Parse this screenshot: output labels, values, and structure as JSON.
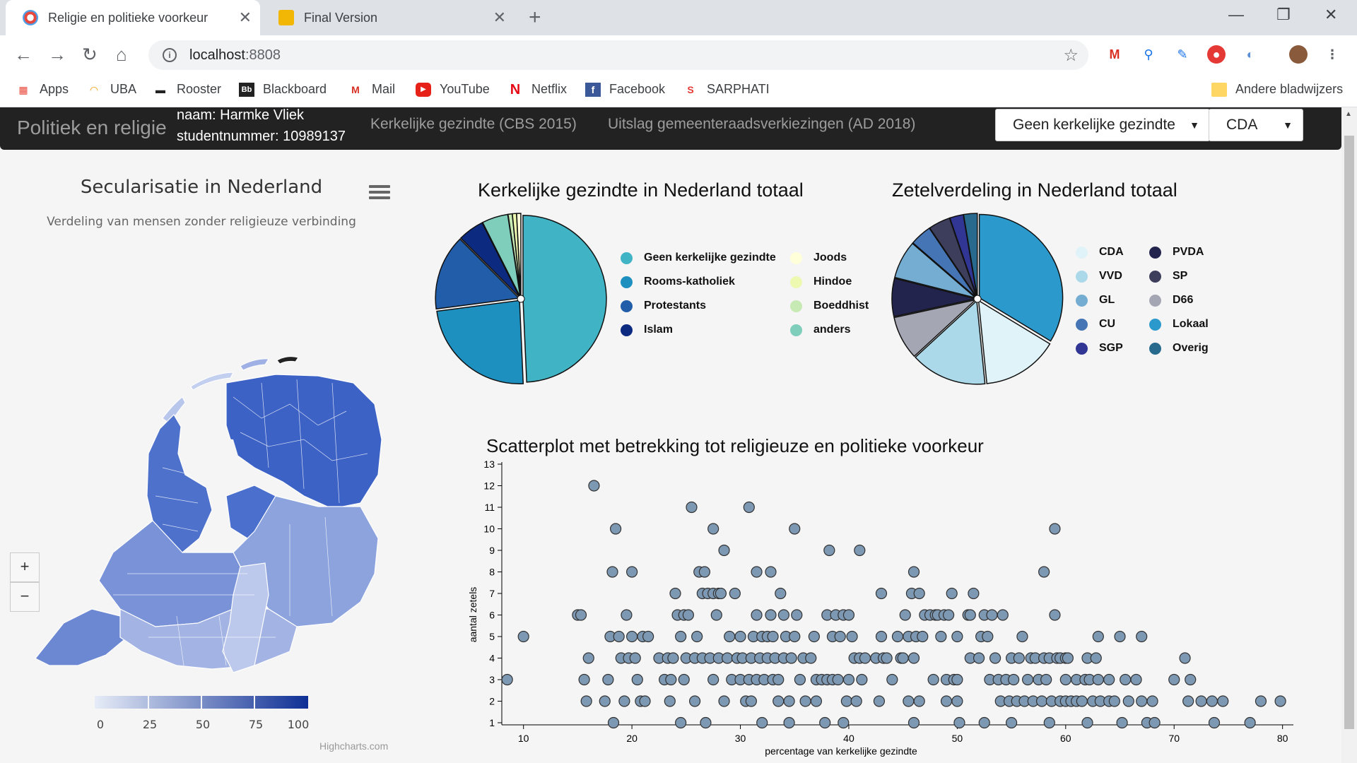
{
  "browser": {
    "tabs": [
      {
        "title": "Religie en politieke voorkeur",
        "active": true
      },
      {
        "title": "Final Version",
        "active": false
      }
    ],
    "url_host": "localhost",
    "url_port": ":8808",
    "bookmarks": [
      "Apps",
      "UBA",
      "Rooster",
      "Blackboard",
      "Mail",
      "YouTube",
      "Netflix",
      "Facebook",
      "SARPHATI"
    ],
    "other_bookmarks": "Andere bladwijzers"
  },
  "navbar": {
    "brand": "Politiek en religie",
    "student_name": "naam: Harmke Vliek",
    "student_number": "studentnummer: 10989137",
    "link_cbs": "Kerkelijke gezindte (CBS 2015)",
    "link_ad": "Uitslag gemeenteraadsverkiezingen (AD 2018)",
    "select_religion": "Geen kerkelijke gezindte",
    "select_party": "CDA"
  },
  "map": {
    "title": "Secularisatie in Nederland",
    "subtitle": "Verdeling van mensen zonder religieuze verbinding",
    "zoom_in": "+",
    "zoom_out": "−",
    "legend_labels": [
      "0",
      "25",
      "50",
      "75",
      "100"
    ],
    "credits": "Highcharts.com"
  },
  "colors": {
    "navbar_bg": "#222222",
    "map_low": "#e6ecf7",
    "map_high": "#0e2f95",
    "scatter_point": "#7d98b3"
  },
  "chart_data": [
    {
      "type": "pie",
      "title": "Kerkelijke gezindte in Nederland totaal",
      "slices": [
        {
          "label": "Geen kerkelijke gezindte",
          "value": 49.0,
          "color": "#40b4c4"
        },
        {
          "label": "Rooms-katholiek",
          "value": 23.5,
          "color": "#1d90c0"
        },
        {
          "label": "Protestants",
          "value": 14.5,
          "color": "#215da8"
        },
        {
          "label": "Islam",
          "value": 5.0,
          "color": "#0c2a80"
        },
        {
          "label": "anders",
          "value": 5.0,
          "color": "#7fcdbb"
        },
        {
          "label": "Boeddhist",
          "value": 0.8,
          "color": "#c7e9b4"
        },
        {
          "label": "Hindoe",
          "value": 0.8,
          "color": "#edf8b1"
        },
        {
          "label": "Joods",
          "value": 0.8,
          "color": "#ffffd9"
        }
      ],
      "legend": [
        "Geen kerkelijke gezindte",
        "Rooms-katholiek",
        "Protestants",
        "Islam",
        "Joods",
        "Hindoe",
        "Boeddhist",
        "anders"
      ]
    },
    {
      "type": "pie",
      "title": "Zetelverdeling in Nederland totaal",
      "slices": [
        {
          "label": "Lokaal",
          "value": 32,
          "color": "#2b99cb"
        },
        {
          "label": "CDA",
          "value": 14,
          "color": "#e0f3f8"
        },
        {
          "label": "VVD",
          "value": 14,
          "color": "#abd9e9"
        },
        {
          "label": "D66",
          "value": 8,
          "color": "#a4a6b4"
        },
        {
          "label": "PVDA",
          "value": 7,
          "color": "#23244e"
        },
        {
          "label": "GL",
          "value": 7,
          "color": "#74add1"
        },
        {
          "label": "CU",
          "value": 4,
          "color": "#4575b4"
        },
        {
          "label": "SP",
          "value": 4,
          "color": "#3d3d5c"
        },
        {
          "label": "SGP",
          "value": 2.5,
          "color": "#313695"
        },
        {
          "label": "Overig",
          "value": 2.5,
          "color": "#276a8e"
        }
      ],
      "legend": [
        "CDA",
        "VVD",
        "GL",
        "CU",
        "SGP",
        "PVDA",
        "SP",
        "D66",
        "Lokaal",
        "Overig"
      ]
    },
    {
      "type": "scatter",
      "title": "Scatterplot met betrekking tot religieuze en politieke voorkeur",
      "xlabel": "percentage van kerkelijke gezindte",
      "ylabel": "aantal zetels",
      "xlim": [
        8,
        81
      ],
      "ylim": [
        1,
        13
      ],
      "xticks": [
        10,
        20,
        30,
        40,
        50,
        60,
        70,
        80
      ],
      "yticks": [
        1,
        2,
        3,
        4,
        5,
        6,
        7,
        8,
        9,
        10,
        11,
        12,
        13
      ],
      "points": [
        [
          8.5,
          3
        ],
        [
          10,
          5
        ],
        [
          15,
          6
        ],
        [
          15.3,
          6
        ],
        [
          15.6,
          3
        ],
        [
          15.8,
          2
        ],
        [
          16,
          4
        ],
        [
          16.5,
          12
        ],
        [
          17.5,
          2
        ],
        [
          17.8,
          3
        ],
        [
          18,
          5
        ],
        [
          18.2,
          8
        ],
        [
          18.3,
          1
        ],
        [
          18.5,
          10
        ],
        [
          18.8,
          5
        ],
        [
          19,
          4
        ],
        [
          19.3,
          2
        ],
        [
          19.5,
          6
        ],
        [
          19.7,
          4
        ],
        [
          20,
          8
        ],
        [
          20,
          5
        ],
        [
          20.3,
          4
        ],
        [
          20.5,
          3
        ],
        [
          20.8,
          2
        ],
        [
          21,
          5
        ],
        [
          21.2,
          2
        ],
        [
          21.5,
          5
        ],
        [
          22.5,
          4
        ],
        [
          23,
          3
        ],
        [
          23.3,
          4
        ],
        [
          23.5,
          2
        ],
        [
          23.6,
          3
        ],
        [
          23.8,
          4
        ],
        [
          24,
          7
        ],
        [
          24.2,
          6
        ],
        [
          24.5,
          5
        ],
        [
          24.5,
          1
        ],
        [
          24.8,
          6
        ],
        [
          24.8,
          3
        ],
        [
          25,
          4
        ],
        [
          25.2,
          6
        ],
        [
          25.5,
          11
        ],
        [
          25.8,
          2
        ],
        [
          25.8,
          4
        ],
        [
          26,
          5
        ],
        [
          26.2,
          8
        ],
        [
          26.5,
          4
        ],
        [
          26.5,
          7
        ],
        [
          26.7,
          8
        ],
        [
          26.8,
          1
        ],
        [
          27,
          7
        ],
        [
          27.2,
          4
        ],
        [
          27.5,
          10
        ],
        [
          27.5,
          7
        ],
        [
          27.5,
          3
        ],
        [
          27.8,
          6
        ],
        [
          28,
          7
        ],
        [
          28,
          4
        ],
        [
          28.2,
          7
        ],
        [
          28.5,
          2
        ],
        [
          28.5,
          9
        ],
        [
          28.8,
          4
        ],
        [
          29,
          5
        ],
        [
          29.2,
          3
        ],
        [
          29.5,
          7
        ],
        [
          29.7,
          4
        ],
        [
          30,
          5
        ],
        [
          30,
          3
        ],
        [
          30.2,
          4
        ],
        [
          30.5,
          2
        ],
        [
          30.8,
          11
        ],
        [
          30.8,
          3
        ],
        [
          31,
          2
        ],
        [
          31,
          4
        ],
        [
          31.2,
          5
        ],
        [
          31.5,
          8
        ],
        [
          31.5,
          6
        ],
        [
          31.5,
          3
        ],
        [
          31.8,
          4
        ],
        [
          32,
          5
        ],
        [
          32,
          1
        ],
        [
          32.2,
          3
        ],
        [
          32.5,
          4
        ],
        [
          32.5,
          5
        ],
        [
          32.8,
          6
        ],
        [
          32.8,
          8
        ],
        [
          33,
          3
        ],
        [
          33,
          5
        ],
        [
          33.2,
          4
        ],
        [
          33.5,
          2
        ],
        [
          33.5,
          3
        ],
        [
          33.7,
          7
        ],
        [
          34,
          6
        ],
        [
          34,
          4
        ],
        [
          34.2,
          5
        ],
        [
          34.5,
          2
        ],
        [
          34.5,
          1
        ],
        [
          34.7,
          4
        ],
        [
          35,
          5
        ],
        [
          35,
          10
        ],
        [
          35.2,
          6
        ],
        [
          35.5,
          3
        ],
        [
          35.8,
          4
        ],
        [
          36,
          2
        ],
        [
          36.5,
          4
        ],
        [
          36.8,
          5
        ],
        [
          37,
          3
        ],
        [
          37,
          2
        ],
        [
          37.5,
          3
        ],
        [
          37.8,
          1
        ],
        [
          38,
          6
        ],
        [
          38,
          3
        ],
        [
          38.2,
          9
        ],
        [
          38.5,
          5
        ],
        [
          38.5,
          3
        ],
        [
          38.8,
          6
        ],
        [
          39,
          3
        ],
        [
          39.2,
          5
        ],
        [
          39.5,
          6
        ],
        [
          39.5,
          1
        ],
        [
          39.8,
          2
        ],
        [
          40,
          6
        ],
        [
          40,
          3
        ],
        [
          40.3,
          5
        ],
        [
          40.5,
          4
        ],
        [
          40.7,
          2
        ],
        [
          41,
          4
        ],
        [
          41,
          9
        ],
        [
          41.2,
          3
        ],
        [
          41.5,
          4
        ],
        [
          42.5,
          4
        ],
        [
          42.8,
          2
        ],
        [
          43,
          7
        ],
        [
          43,
          5
        ],
        [
          43.2,
          4
        ],
        [
          43.5,
          4
        ],
        [
          44,
          3
        ],
        [
          44.5,
          5
        ],
        [
          44.8,
          4
        ],
        [
          45,
          4
        ],
        [
          45.2,
          6
        ],
        [
          45.5,
          2
        ],
        [
          45.5,
          5
        ],
        [
          45.8,
          7
        ],
        [
          46,
          4
        ],
        [
          46,
          8
        ],
        [
          46,
          1
        ],
        [
          46.2,
          5
        ],
        [
          46.5,
          7
        ],
        [
          46.5,
          2
        ],
        [
          46.8,
          5
        ],
        [
          47,
          6
        ],
        [
          47.5,
          6
        ],
        [
          47.8,
          3
        ],
        [
          48,
          6
        ],
        [
          48.2,
          6
        ],
        [
          48.5,
          5
        ],
        [
          48.8,
          6
        ],
        [
          49,
          3
        ],
        [
          49,
          2
        ],
        [
          49.2,
          6
        ],
        [
          49.5,
          7
        ],
        [
          49.7,
          3
        ],
        [
          50,
          5
        ],
        [
          50,
          3
        ],
        [
          50,
          2
        ],
        [
          50.2,
          1
        ],
        [
          51,
          6
        ],
        [
          51.2,
          6
        ],
        [
          51.2,
          4
        ],
        [
          51.5,
          7
        ],
        [
          52,
          4
        ],
        [
          52.2,
          5
        ],
        [
          52.5,
          6
        ],
        [
          52.5,
          1
        ],
        [
          52.8,
          5
        ],
        [
          53,
          3
        ],
        [
          53.2,
          6
        ],
        [
          53.5,
          4
        ],
        [
          53.8,
          3
        ],
        [
          54,
          2
        ],
        [
          54.2,
          6
        ],
        [
          54.5,
          3
        ],
        [
          54.8,
          2
        ],
        [
          55,
          4
        ],
        [
          55,
          1
        ],
        [
          55.2,
          3
        ],
        [
          55.5,
          2
        ],
        [
          55.7,
          4
        ],
        [
          56,
          5
        ],
        [
          56.2,
          2
        ],
        [
          56.5,
          3
        ],
        [
          56.8,
          4
        ],
        [
          57,
          2
        ],
        [
          57.2,
          4
        ],
        [
          57.5,
          3
        ],
        [
          57.8,
          2
        ],
        [
          58,
          8
        ],
        [
          58,
          4
        ],
        [
          58.2,
          3
        ],
        [
          58.5,
          1
        ],
        [
          58.5,
          4
        ],
        [
          58.7,
          2
        ],
        [
          59,
          6
        ],
        [
          59,
          10
        ],
        [
          59.2,
          4
        ],
        [
          59.5,
          2
        ],
        [
          59.5,
          4
        ],
        [
          60,
          4
        ],
        [
          60,
          3
        ],
        [
          60,
          2
        ],
        [
          60.2,
          4
        ],
        [
          60.5,
          2
        ],
        [
          61,
          3
        ],
        [
          61,
          2
        ],
        [
          61.5,
          2
        ],
        [
          61.8,
          3
        ],
        [
          62,
          1
        ],
        [
          62,
          4
        ],
        [
          62.2,
          3
        ],
        [
          62.5,
          2
        ],
        [
          62.8,
          4
        ],
        [
          63,
          5
        ],
        [
          63,
          3
        ],
        [
          63.2,
          2
        ],
        [
          64,
          2
        ],
        [
          64,
          3
        ],
        [
          64.5,
          2
        ],
        [
          65,
          5
        ],
        [
          65.2,
          1
        ],
        [
          65.5,
          3
        ],
        [
          65.8,
          2
        ],
        [
          66.5,
          3
        ],
        [
          67,
          5
        ],
        [
          67,
          2
        ],
        [
          67.5,
          1
        ],
        [
          68,
          2
        ],
        [
          68.2,
          1
        ],
        [
          70,
          3
        ],
        [
          71,
          4
        ],
        [
          71.3,
          2
        ],
        [
          71.5,
          3
        ],
        [
          72.5,
          2
        ],
        [
          73.5,
          2
        ],
        [
          73.7,
          1
        ],
        [
          74.5,
          2
        ],
        [
          77,
          1
        ],
        [
          78,
          2
        ],
        [
          79.8,
          2
        ]
      ]
    }
  ]
}
